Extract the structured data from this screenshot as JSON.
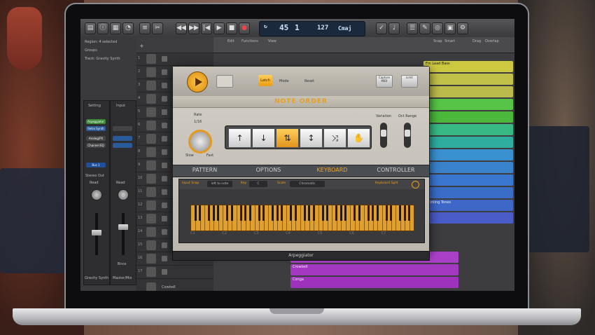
{
  "control_bar": {
    "lcd": {
      "bar": "45",
      "beat": "1",
      "tempo": "127",
      "key": "Cmaj"
    }
  },
  "inspector": {
    "region_label": "Region: 4 selected",
    "groups_label": "Groups",
    "track_label": "Track: Gravity Synth",
    "setting_label": "Setting",
    "input_label": "Input",
    "plugins": [
      "Arpeggiator",
      "Retro Synth"
    ],
    "inserts": [
      "Analog/Flt",
      "Channel EQ"
    ],
    "bus_label": "Bus 1",
    "stereo_out": "Stereo Out",
    "read_labels": [
      "Read",
      "Read"
    ],
    "bounce_label": "Bnce",
    "strip_names": [
      "Gravity Synth",
      "Master/Mix"
    ]
  },
  "tracks": [
    {
      "num": "1"
    },
    {
      "num": "2"
    },
    {
      "num": "3"
    },
    {
      "num": "4"
    },
    {
      "num": "5"
    },
    {
      "num": "6"
    },
    {
      "num": "7"
    },
    {
      "num": "8"
    },
    {
      "num": "9"
    },
    {
      "num": "10"
    },
    {
      "num": "11"
    },
    {
      "num": "12"
    },
    {
      "num": "13"
    },
    {
      "num": "14"
    },
    {
      "num": "15"
    },
    {
      "num": "16"
    },
    {
      "num": "17"
    }
  ],
  "bottom_tracks": [
    "Cowbell",
    "Conga"
  ],
  "arrange": {
    "edit_menu": "Edit",
    "functions_menu": "Functions",
    "view_menu": "View",
    "snap_label": "Snap",
    "snap_value": "Smart",
    "drag_label": "Drag",
    "drag_value": "Overlap",
    "regions": [
      {
        "label": "Gravity Synth - Classic Cycle 01",
        "color": "#8a8a8a"
      },
      {
        "label": "Fm Lead Bass",
        "color": "#d4d040"
      },
      {
        "label": "Working Tones",
        "color": "#3a7ad8"
      },
      {
        "label": "Crowbell",
        "color": "#b040d0"
      },
      {
        "label": "Conga",
        "color": "#b040d0"
      }
    ]
  },
  "arpeggiator": {
    "latch_label": "Latch",
    "mode_label": "Mode",
    "reset_label": "Reset",
    "capture_label": "Capture MIDI",
    "limit_label": "Limit",
    "note_order_title": "NOTE ORDER",
    "rate_label": "Rate",
    "rate_value": "1/16",
    "slow_label": "Slow",
    "fast_label": "Fast",
    "variation_label": "Variation",
    "oct_range_label": "Oct Range",
    "directions": [
      "↑",
      "↓",
      "⇅",
      "↕",
      "⤨",
      "✋"
    ],
    "tabs": [
      "PATTERN",
      "OPTIONS",
      "KEYBOARD",
      "CONTROLLER"
    ],
    "active_tab": "KEYBOARD",
    "keyboard": {
      "input_label": "Input Snap",
      "input_value": "left to note",
      "key_label": "Key",
      "key_value": "C",
      "scale_label": "Scale",
      "scale_value": "Chromatic",
      "keyboard_split_label": "Keyboard Split",
      "octave_labels": [
        "C1",
        "C2",
        "C3",
        "C4",
        "C5",
        "C6",
        "C7"
      ]
    },
    "footer_title": "Arpeggiator"
  },
  "colors": {
    "accent": "#f0a626",
    "lcd": "#1a2a3c"
  }
}
